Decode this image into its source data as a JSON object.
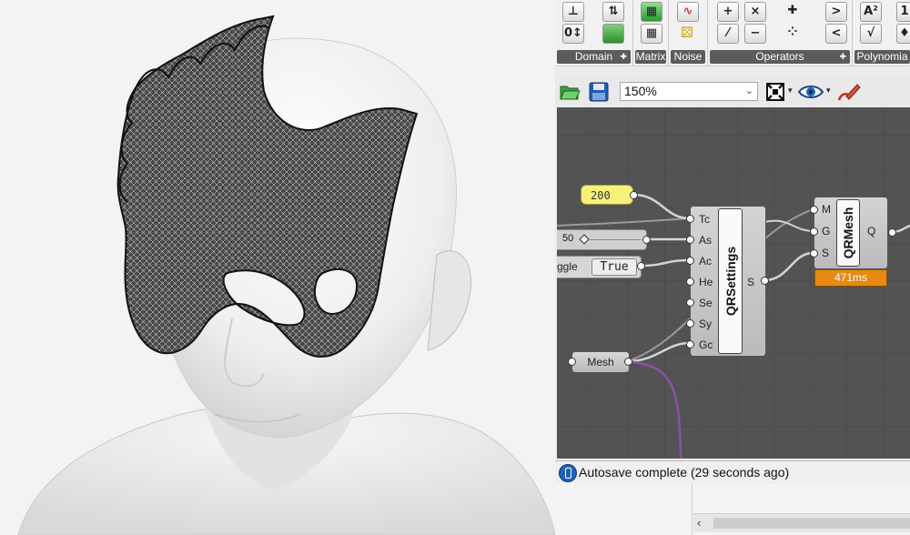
{
  "ribbon": {
    "groups": [
      {
        "label": "Domain",
        "has_expand": true,
        "icons": [
          "domain-bounds-icon",
          "remap-numbers-icon"
        ]
      },
      {
        "label": "Matrix",
        "has_expand": false,
        "icons": [
          "matrix-green-icon",
          "matrix-grid-icon"
        ]
      },
      {
        "label": "Noise",
        "has_expand": false,
        "icons": [
          "noise-graph-icon",
          "noise-dice-icon"
        ]
      },
      {
        "label": "Operators",
        "has_expand": true,
        "icons": [
          "addition-icon",
          "multiplication-icon",
          "mass-addition-icon",
          "division-icon",
          "subtraction-icon",
          "series-icon"
        ]
      },
      {
        "label": "Polynomia",
        "has_expand": false,
        "icons": [
          "greater-than-icon",
          "less-than-icon",
          "power-icon",
          "square-root-icon"
        ]
      }
    ],
    "operator_glyphs": {
      "add": "+",
      "mul": "×",
      "div": "⁄",
      "sub": "−",
      "gt": ">",
      "lt": "<"
    },
    "poly_glyphs": {
      "power": "A²",
      "sqrt": "√"
    }
  },
  "toolbar": {
    "zoom_value": "150%"
  },
  "canvas": {
    "number_panel": "200",
    "slider_value": "50",
    "toggle_label": "ggle",
    "toggle_value": "True",
    "mesh_param": "Mesh",
    "qrsettings": {
      "title": "QRSettings",
      "inputs": [
        "Tc",
        "As",
        "Ac",
        "He",
        "Se",
        "Sy",
        "Gc"
      ],
      "outputs": [
        "S"
      ]
    },
    "qrmesh": {
      "title": "QRMesh",
      "inputs": [
        "M",
        "G",
        "S"
      ],
      "outputs": [
        "Q"
      ],
      "timer": "471ms"
    },
    "colors": {
      "canvas_bg": "#535353",
      "panel_yellow": "#f9f07a",
      "timer_orange": "#e68a12",
      "wire_purple": "#8e4fa8"
    }
  },
  "status": {
    "text": "Autosave complete (29 seconds ago)"
  }
}
